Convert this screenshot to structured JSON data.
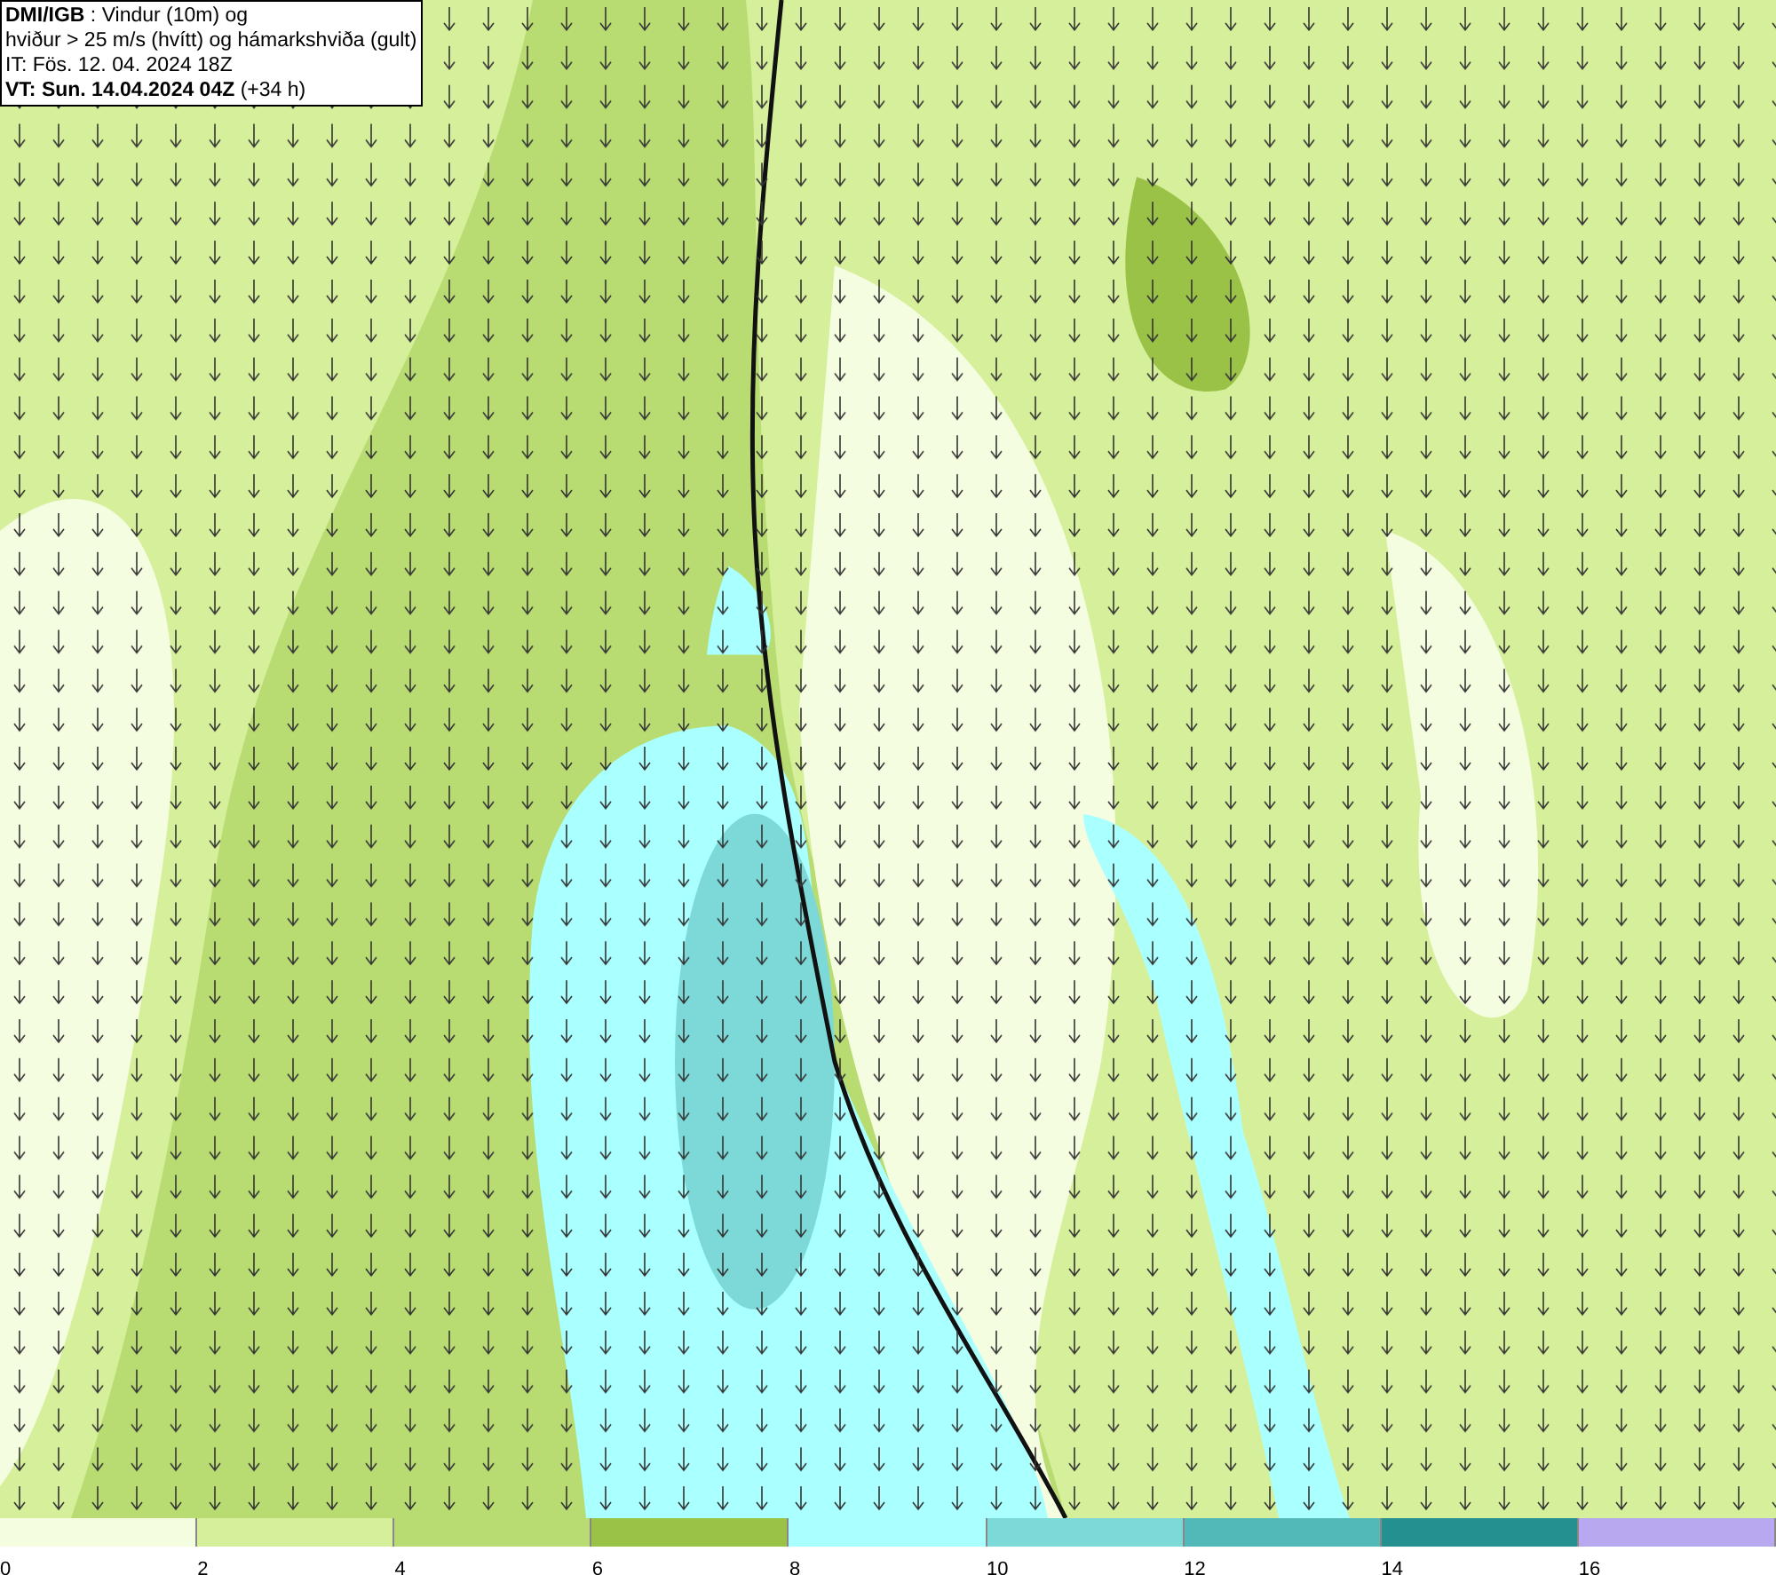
{
  "info_box": {
    "lines": [
      "**DMI/IGB** : Vindur (10m) og",
      "hviður > 25 m/s (hvítt) og hámarkshviða (gult)",
      "IT: Fös. 12. 04. 2024 18Z",
      "**VT: Sun. 14.04.2024 04Z** (+34 h)"
    ]
  },
  "legend": {
    "bins": [
      {
        "color": "#f4fde0",
        "label": "0"
      },
      {
        "color": "#d6ef9a",
        "label": "2"
      },
      {
        "color": "#b8dc72",
        "label": "4"
      },
      {
        "color": "#9ac246",
        "label": "6"
      },
      {
        "color": "#aaffff",
        "label": "8"
      },
      {
        "color": "#7dd8d8",
        "label": "10"
      },
      {
        "color": "#52b8b8",
        "label": "12"
      },
      {
        "color": "#259090",
        "label": "14"
      },
      {
        "color": "#b8a8f0",
        "label": "16"
      }
    ]
  }
}
